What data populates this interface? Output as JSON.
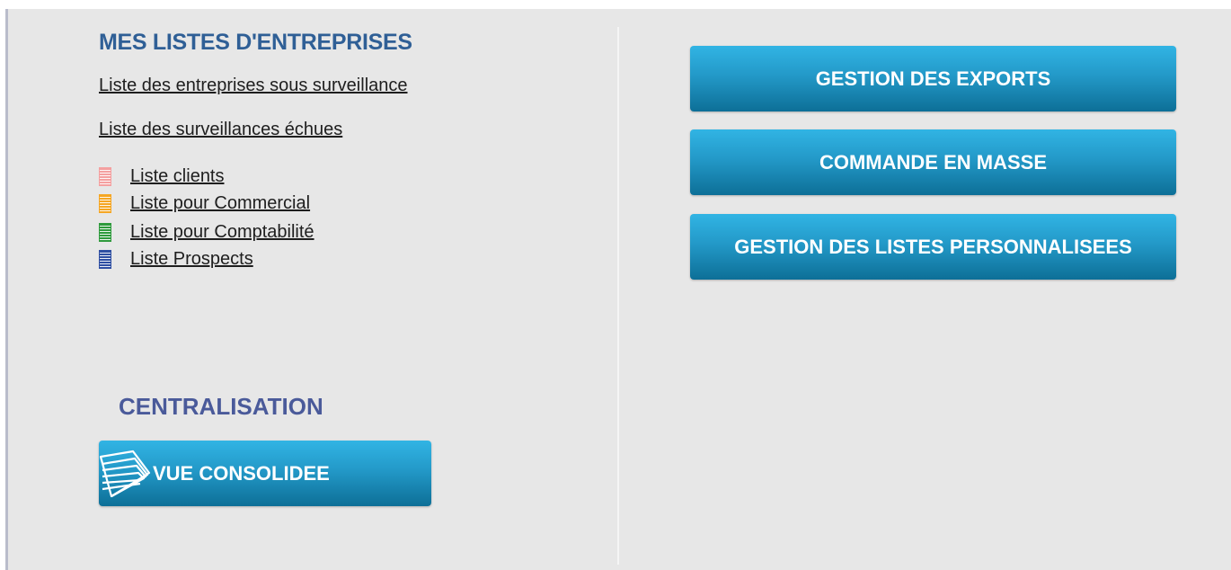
{
  "lists_section": {
    "title": "MES LISTES D'ENTREPRISES",
    "links": [
      "Liste des entreprises sous surveillance",
      "Liste des surveillances échues"
    ],
    "custom_lists": [
      {
        "label": "Liste clients",
        "icon": "list-icon-pink",
        "color": "#f4a0a0"
      },
      {
        "label": "Liste pour Commercial",
        "icon": "list-icon-orange",
        "color": "#f5a623"
      },
      {
        "label": "Liste pour Comptabilité",
        "icon": "list-icon-green",
        "color": "#2e9a3c"
      },
      {
        "label": "Liste Prospects",
        "icon": "list-icon-blue",
        "color": "#2f4fa2"
      }
    ]
  },
  "centralisation": {
    "title": "CENTRALISATION",
    "button_label": "VUE CONSOLIDEE",
    "button_icon": "documents-stack-icon"
  },
  "actions": [
    "GESTION DES EXPORTS",
    "COMMANDE EN MASSE",
    "GESTION DES LISTES PERSONNALISEES"
  ],
  "colors": {
    "title": "#2f5f96",
    "centralisation_title": "#4a5a9a",
    "button_top": "#31b4e4",
    "button_bottom": "#0d6f97",
    "panel_background": "#e7e7e7"
  }
}
